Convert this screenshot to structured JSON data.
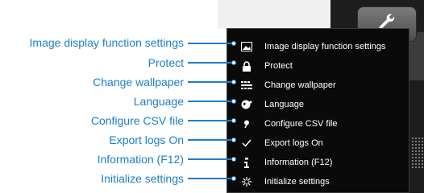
{
  "callouts": [
    "Image display function settings",
    "Protect",
    "Change wallpaper",
    "Language",
    "Configure CSV file",
    "Export logs On",
    "Information (F12)",
    "Initialize settings"
  ],
  "menu": {
    "items": [
      {
        "label": "Image display function settings",
        "icon": "image-icon"
      },
      {
        "label": "Protect",
        "icon": "lock-icon"
      },
      {
        "label": "Change wallpaper",
        "icon": "wallpaper-icon"
      },
      {
        "label": "Language",
        "icon": "globe-icon"
      },
      {
        "label": "Configure CSV file",
        "icon": "csv-icon"
      },
      {
        "label": "Export logs On",
        "icon": "checkmark-icon"
      },
      {
        "label": "Information (F12)",
        "icon": "info-icon"
      },
      {
        "label": "Initialize settings",
        "icon": "reset-icon"
      }
    ]
  },
  "colors": {
    "callout": "#1e7ec8",
    "menu_bg": "#0a0a0a",
    "menu_text": "#ffffff"
  }
}
